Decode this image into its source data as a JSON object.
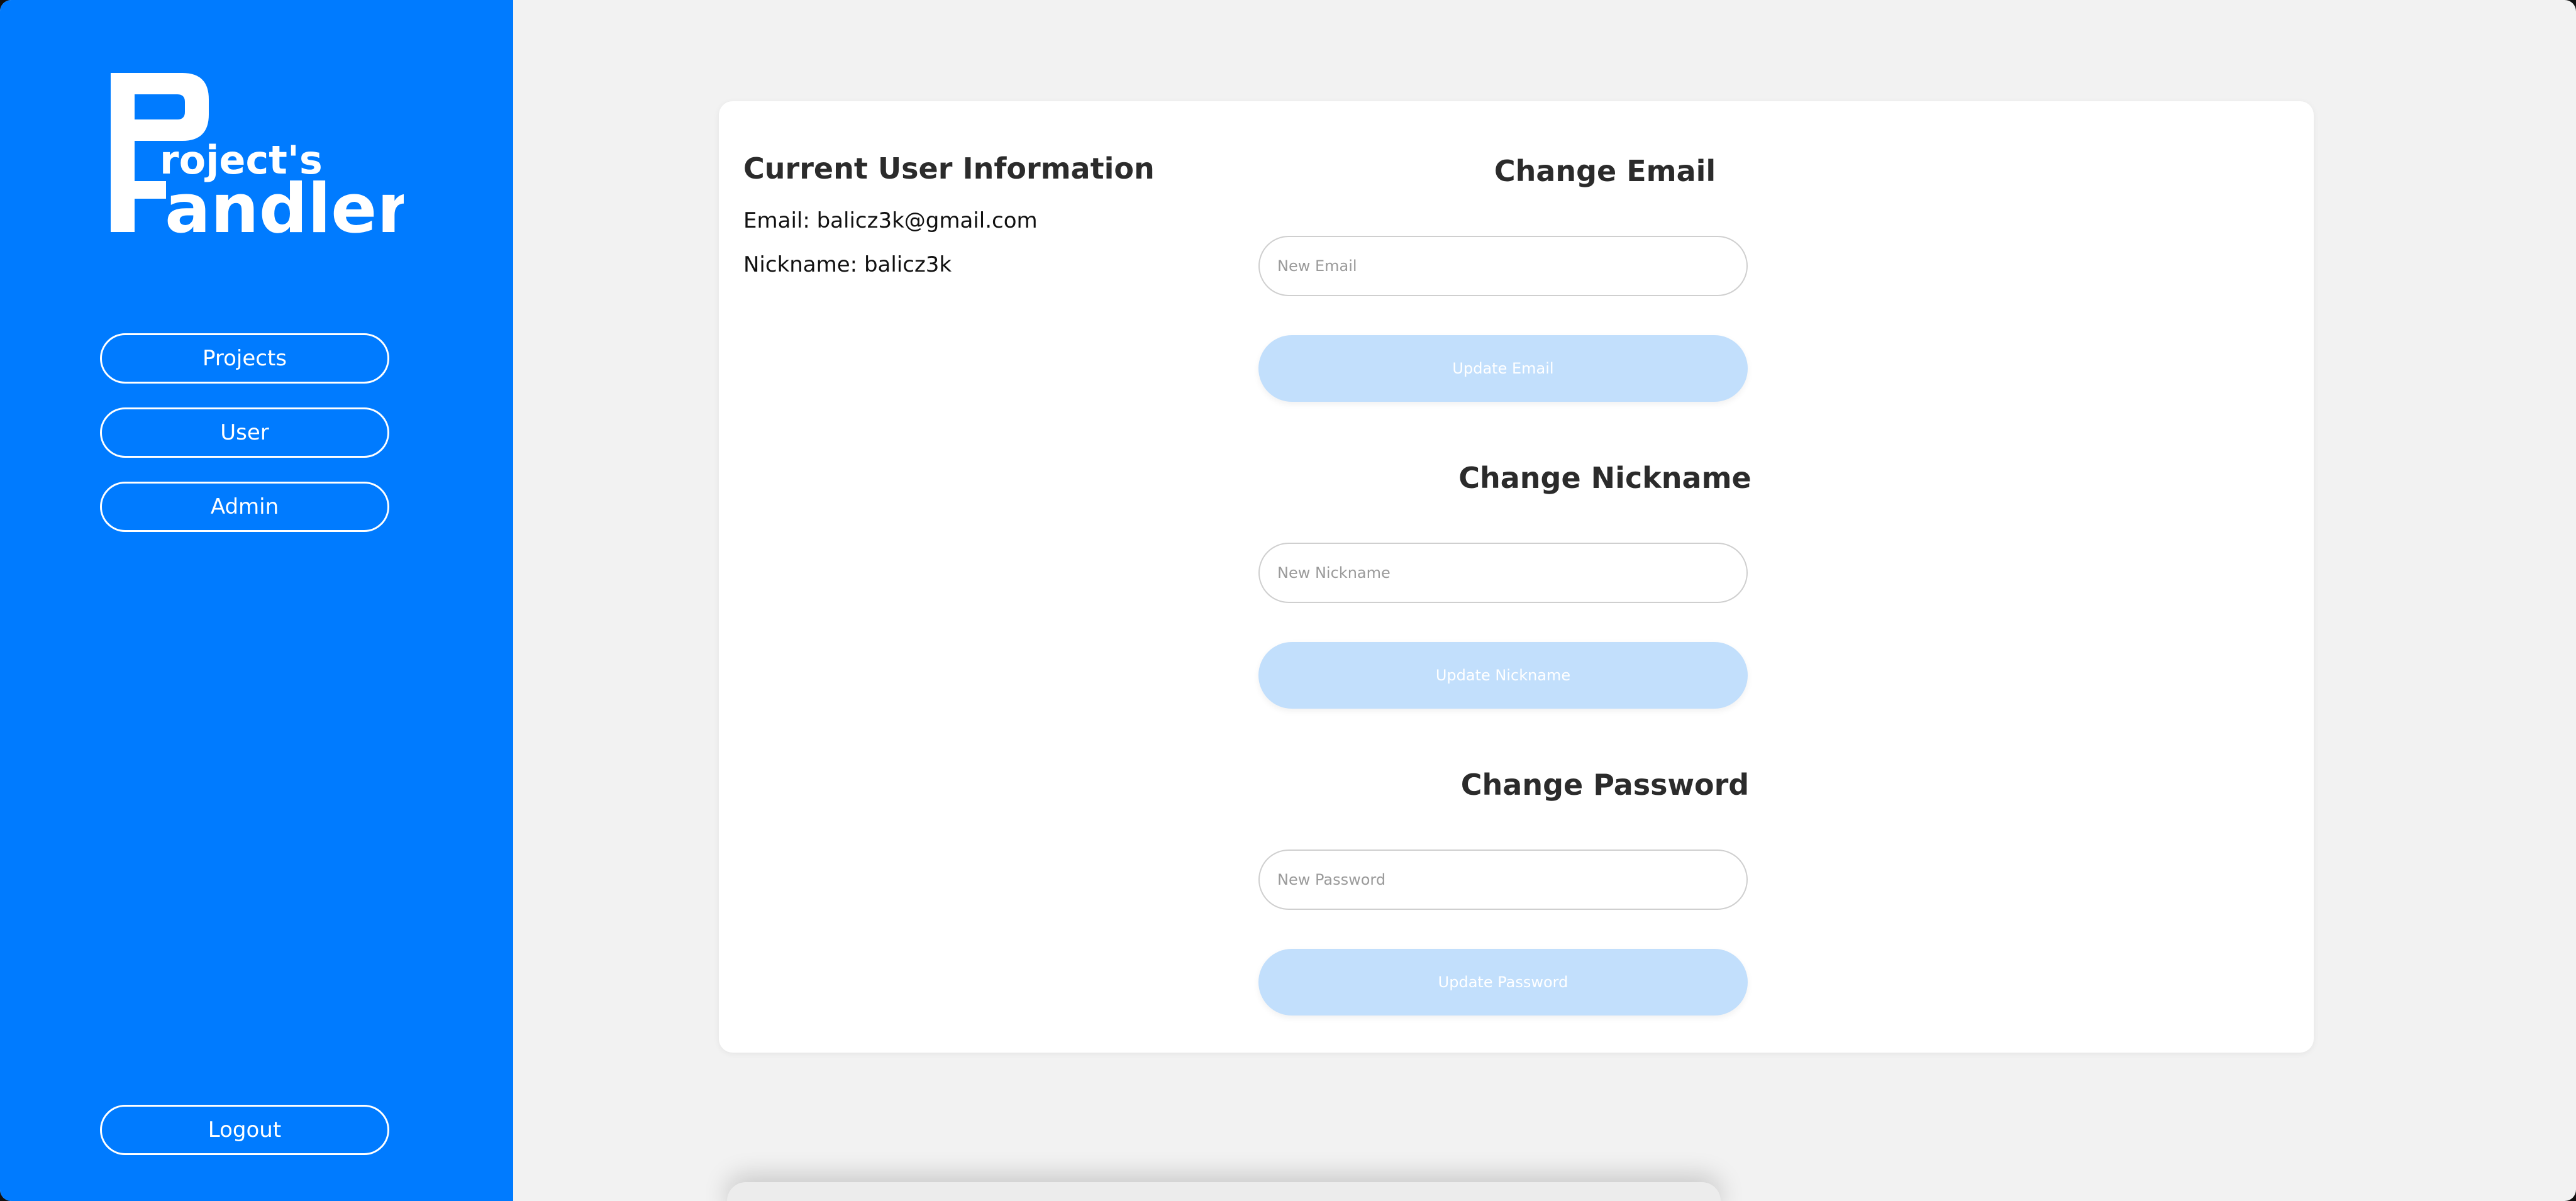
{
  "sidebar": {
    "logo": {
      "big_letter_top": "P",
      "small_text": "roject's",
      "big_word": "Handler"
    },
    "nav": [
      {
        "label": "Projects"
      },
      {
        "label": "User"
      },
      {
        "label": "Admin"
      }
    ],
    "logout_label": "Logout"
  },
  "user_info": {
    "title": "Current User Information",
    "email_line": "Email: balicz3k@gmail.com",
    "nickname_line": "Nickname: balicz3k"
  },
  "forms": {
    "email": {
      "title": "Change Email",
      "placeholder": "New Email",
      "value": "",
      "button_label": "Update Email"
    },
    "nickname": {
      "title": "Change Nickname",
      "placeholder": "New Nickname",
      "value": "",
      "button_label": "Update Nickname"
    },
    "password": {
      "title": "Change Password",
      "placeholder": "New Password",
      "value": "",
      "button_label": "Update Password"
    }
  },
  "colors": {
    "sidebar_bg": "#007bff",
    "main_bg": "#f2f2f2",
    "button_disabled": "#c2dffc"
  }
}
